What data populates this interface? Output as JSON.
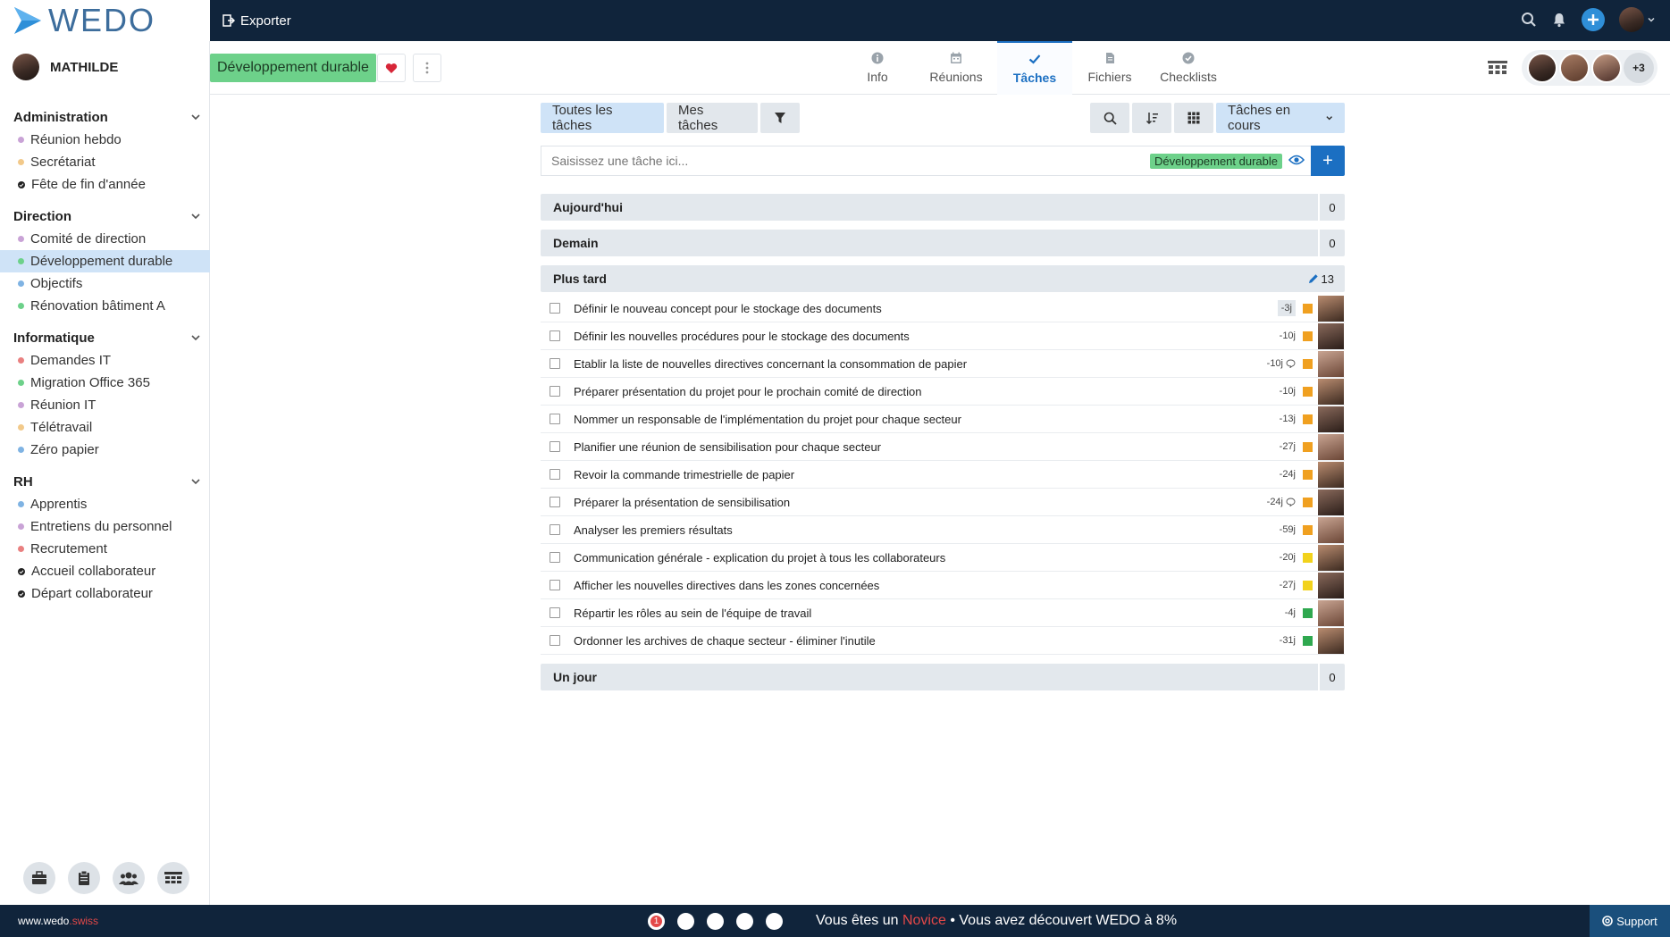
{
  "app": {
    "logo_text": "WEDO",
    "user_name": "MATHILDE"
  },
  "colors": {
    "accent": "#1b6fc2",
    "topbar": "#10243b",
    "project_tag": "#6dd18a",
    "active_nav": "#cfe3f7",
    "novice": "#e34848"
  },
  "sidebar": {
    "groups": [
      {
        "label": "Administration",
        "items": [
          {
            "label": "Réunion hebdo",
            "color": "#c9a3d6",
            "kind": "dot"
          },
          {
            "label": "Secrétariat",
            "color": "#f2c98a",
            "kind": "dot"
          },
          {
            "label": "Fête de fin d'année",
            "kind": "check"
          }
        ]
      },
      {
        "label": "Direction",
        "items": [
          {
            "label": "Comité de direction",
            "color": "#c9a3d6",
            "kind": "dot"
          },
          {
            "label": "Développement durable",
            "color": "#6dd18a",
            "kind": "dot",
            "active": true
          },
          {
            "label": "Objectifs",
            "color": "#7fb3e3",
            "kind": "dot"
          },
          {
            "label": "Rénovation bâtiment A",
            "color": "#6dd18a",
            "kind": "dot"
          }
        ]
      },
      {
        "label": "Informatique",
        "items": [
          {
            "label": "Demandes IT",
            "color": "#e98080",
            "kind": "dot"
          },
          {
            "label": "Migration Office 365",
            "color": "#6dd18a",
            "kind": "dot"
          },
          {
            "label": "Réunion IT",
            "color": "#c9a3d6",
            "kind": "dot"
          },
          {
            "label": "Télétravail",
            "color": "#f2c98a",
            "kind": "dot"
          },
          {
            "label": "Zéro papier",
            "color": "#7fb3e3",
            "kind": "dot"
          }
        ]
      },
      {
        "label": "RH",
        "items": [
          {
            "label": "Apprentis",
            "color": "#7fb3e3",
            "kind": "dot"
          },
          {
            "label": "Entretiens du personnel",
            "color": "#c9a3d6",
            "kind": "dot"
          },
          {
            "label": "Recrutement",
            "color": "#e98080",
            "kind": "dot"
          },
          {
            "label": "Accueil collaborateur",
            "kind": "check"
          },
          {
            "label": "Départ collaborateur",
            "kind": "check"
          }
        ]
      }
    ],
    "bottom_icons": [
      "briefcase-icon",
      "clipboard-icon",
      "people-icon",
      "board-icon"
    ]
  },
  "topbar": {
    "export_label": "Exporter"
  },
  "header": {
    "project_name": "Développement durable",
    "tabs": [
      {
        "label": "Info",
        "icon": "info-icon"
      },
      {
        "label": "Réunions",
        "icon": "calendar-icon"
      },
      {
        "label": "Tâches",
        "icon": "check-icon",
        "active": true
      },
      {
        "label": "Fichiers",
        "icon": "file-icon"
      },
      {
        "label": "Checklists",
        "icon": "checklist-icon"
      }
    ],
    "members_more": "+3"
  },
  "toolbar": {
    "all_tasks": "Toutes les tâches",
    "my_tasks": "Mes tâches",
    "status_filter": "Tâches en cours"
  },
  "task_input": {
    "placeholder": "Saisissez une tâche ici...",
    "tag": "Développement durable",
    "add_label": "+"
  },
  "sections": {
    "today": {
      "label": "Aujourd'hui",
      "count": "0"
    },
    "tomorrow": {
      "label": "Demain",
      "count": "0"
    },
    "later": {
      "label": "Plus tard",
      "count": "13"
    },
    "someday": {
      "label": "Un jour",
      "count": "0"
    }
  },
  "tasks": [
    {
      "label": "Définir le nouveau concept pour le stockage des documents",
      "due": "-3j",
      "priority": "#f0a020",
      "comment": false
    },
    {
      "label": "Définir les nouvelles procédures pour le stockage des documents",
      "due": "-10j",
      "priority": "#f0a020",
      "comment": false
    },
    {
      "label": "Etablir la liste de nouvelles directives concernant la consommation de papier",
      "due": "-10j",
      "priority": "#f0a020",
      "comment": true
    },
    {
      "label": "Préparer présentation du projet pour le prochain comité de direction",
      "due": "-10j",
      "priority": "#f0a020",
      "comment": false
    },
    {
      "label": "Nommer un responsable de l'implémentation du projet pour chaque secteur",
      "due": "-13j",
      "priority": "#f0a020",
      "comment": false
    },
    {
      "label": "Planifier une réunion de sensibilisation pour chaque secteur",
      "due": "-27j",
      "priority": "#f0a020",
      "comment": false
    },
    {
      "label": "Revoir la commande trimestrielle de papier",
      "due": "-24j",
      "priority": "#f0a020",
      "comment": false
    },
    {
      "label": "Préparer la présentation de sensibilisation",
      "due": "-24j",
      "priority": "#f0a020",
      "comment": true
    },
    {
      "label": "Analyser les premiers résultats",
      "due": "-59j",
      "priority": "#f0a020",
      "comment": false
    },
    {
      "label": "Communication générale - explication du projet à tous les collaborateurs",
      "due": "-20j",
      "priority": "#f2d21c",
      "comment": false
    },
    {
      "label": "Afficher les nouvelles directives dans les zones concernées",
      "due": "-27j",
      "priority": "#f2d21c",
      "comment": false
    },
    {
      "label": "Répartir les rôles au sein de l'équipe de travail",
      "due": "-4j",
      "priority": "#2fa84f",
      "comment": false
    },
    {
      "label": "Ordonner les archives de chaque secteur - éliminer l'inutile",
      "due": "-31j",
      "priority": "#2fa84f",
      "comment": false
    }
  ],
  "footer": {
    "brand": "www.wedo",
    "brand_suffix": ".swiss",
    "current_step": "1",
    "progress_prefix": "Vous êtes un",
    "level": "Novice",
    "progress_suffix": "• Vous avez découvert WEDO à 8%",
    "support_label": "Support"
  }
}
